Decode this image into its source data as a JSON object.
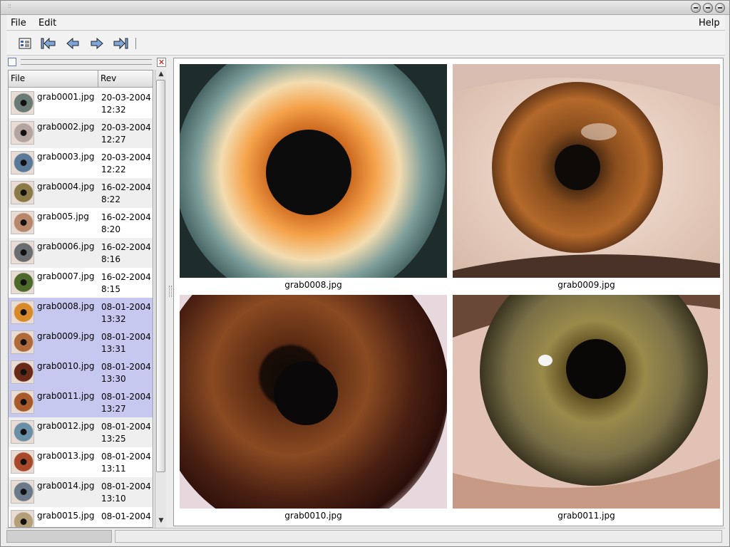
{
  "menubar": {
    "file": "File",
    "edit": "Edit",
    "help": "Help"
  },
  "toolbar": {
    "buttons": [
      "details-view-icon",
      "first-image-icon",
      "previous-image-icon",
      "next-image-icon",
      "last-image-icon"
    ]
  },
  "filelist": {
    "columns": [
      "File",
      "Rev"
    ],
    "rows": [
      {
        "file": "grab0001.jpg",
        "date": "20-03-2004",
        "time": "12:32"
      },
      {
        "file": "grab0002.jpg",
        "date": "20-03-2004",
        "time": "12:27"
      },
      {
        "file": "grab0003.jpg",
        "date": "20-03-2004",
        "time": "12:22"
      },
      {
        "file": "grab0004.jpg",
        "date": "16-02-2004",
        "time": "8:22"
      },
      {
        "file": "grab005.jpg",
        "date": "16-02-2004",
        "time": "8:20"
      },
      {
        "file": "grab0006.jpg",
        "date": "16-02-2004",
        "time": "8:16"
      },
      {
        "file": "grab0007.jpg",
        "date": "16-02-2004",
        "time": "8:15"
      },
      {
        "file": "grab0008.jpg",
        "date": "08-01-2004",
        "time": "13:32"
      },
      {
        "file": "grab0009.jpg",
        "date": "08-01-2004",
        "time": "13:31"
      },
      {
        "file": "grab0010.jpg",
        "date": "08-01-2004",
        "time": "13:30"
      },
      {
        "file": "grab0011.jpg",
        "date": "08-01-2004",
        "time": "13:27"
      },
      {
        "file": "grab0012.jpg",
        "date": "08-01-2004",
        "time": "13:25"
      },
      {
        "file": "grab0013.jpg",
        "date": "08-01-2004",
        "time": "13:11"
      },
      {
        "file": "grab0014.jpg",
        "date": "08-01-2004",
        "time": "13:10"
      },
      {
        "file": "grab0015.jpg",
        "date": "08-01-2004",
        "time": ""
      }
    ],
    "selected": [
      "grab0008.jpg",
      "grab0009.jpg",
      "grab0010.jpg",
      "grab0011.jpg"
    ]
  },
  "viewer": {
    "images": [
      {
        "caption": "grab0008.jpg"
      },
      {
        "caption": "grab0009.jpg"
      },
      {
        "caption": "grab0010.jpg"
      },
      {
        "caption": "grab0011.jpg"
      }
    ]
  },
  "colors": {
    "selection": "#c6c8f0",
    "alt_row": "#efefef"
  }
}
